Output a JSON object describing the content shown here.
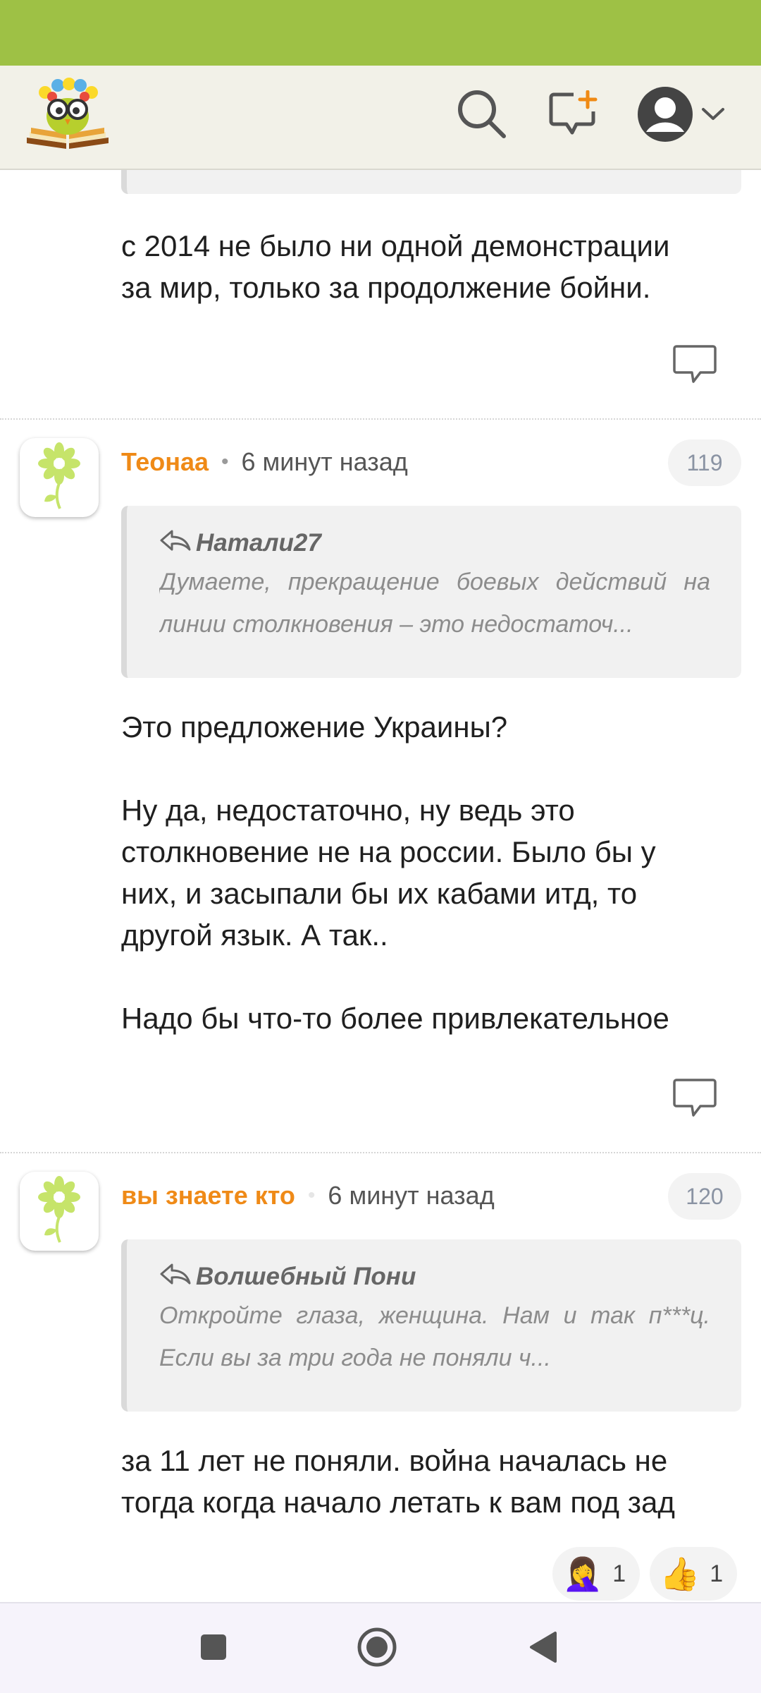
{
  "colors": {
    "status_bar": "#9ec145",
    "header_bg": "#f2f1e8",
    "author": "#ef8a17",
    "quote_bg": "#f1f1f1"
  },
  "header": {
    "logo": "owl-on-book-logo",
    "icons": [
      "search-icon",
      "new-post-icon",
      "avatar-icon",
      "chevron-down-icon"
    ]
  },
  "comments": [
    {
      "text": "с 2014 не было ни одной демонстрации\nза мир, только за продолжение бойни."
    },
    {
      "author": "Теонаа",
      "separator": "•",
      "time": "6 минут назад",
      "number": "119",
      "quote_author": "Натали27",
      "quote_text": "Думаете, прекращение боевых действий на линии столкновения – это недостаточ...",
      "text": "Это предложение Украины?\n\nНу да, недостаточно, ну ведь это\nстолкновение не на россии. Было бы у\nних, и засыпали бы их кабами итд, то\nдругой язык. А так..\n\nНадо бы что-то более привлекательное"
    },
    {
      "author": "вы знаете кто",
      "separator": "•",
      "time": "6 минут назад",
      "number": "120",
      "quote_author": "Волшебный Пони",
      "quote_text": "Откройте глаза, женщина. Нам и так п***ц. Если вы за три года не поняли ч...",
      "text": "за 11 лет не поняли. война началась не\nтогда когда начало летать к вам под зад",
      "reactions": [
        {
          "emoji": "🤦‍♀️",
          "count": "1"
        },
        {
          "emoji": "👍",
          "count": "1"
        }
      ]
    }
  ],
  "navigation": [
    "recents-square-icon",
    "home-circle-icon",
    "back-triangle-icon"
  ]
}
